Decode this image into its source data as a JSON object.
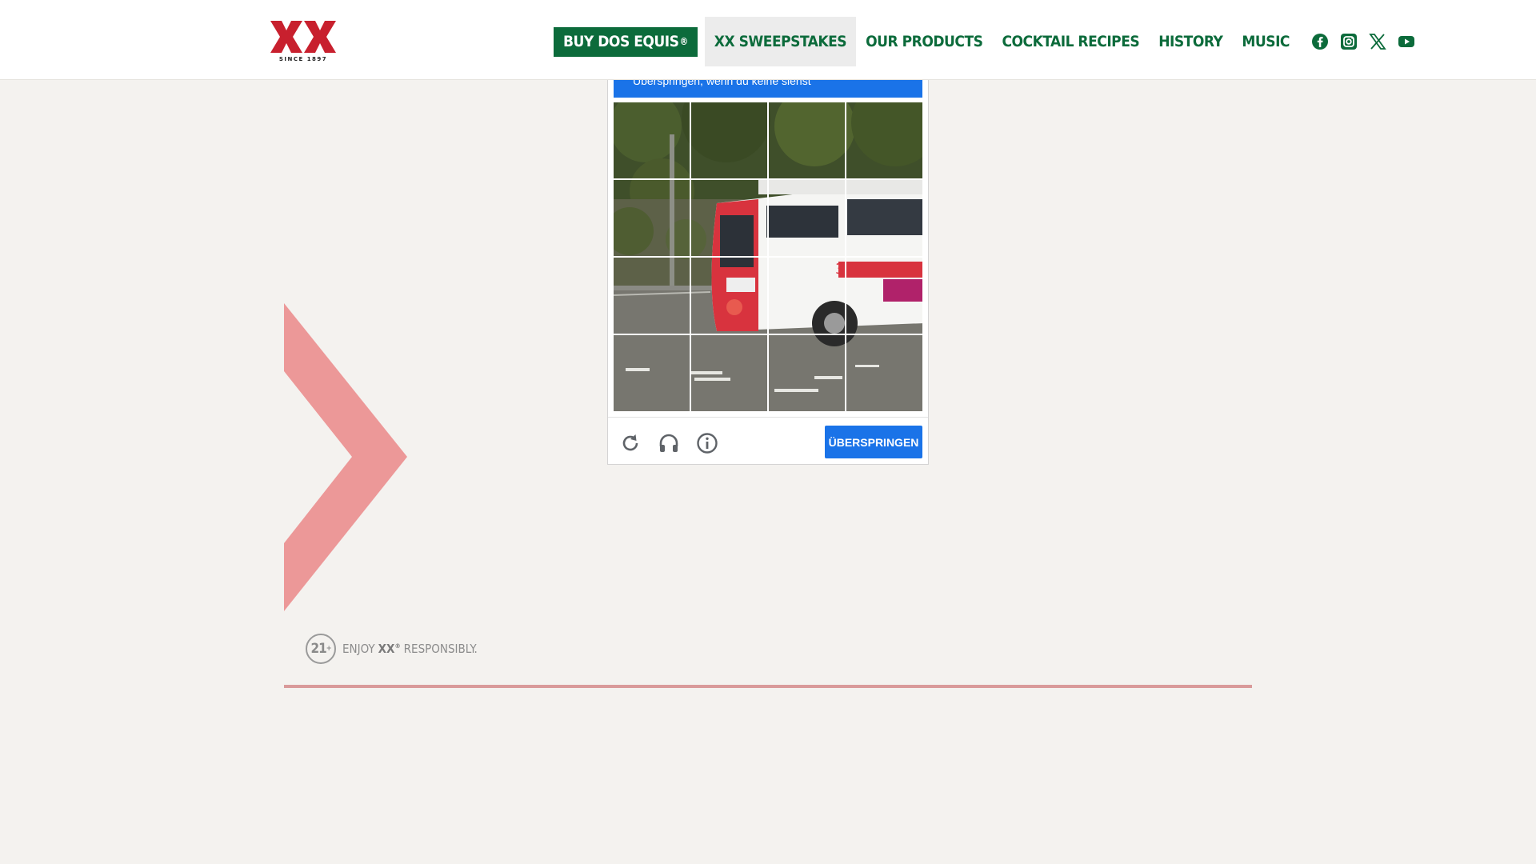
{
  "header": {
    "logo_sub": "SINCE 1897",
    "nav": {
      "buy": "BUY DOS EQUIS",
      "buy_mark": "®",
      "sweepstakes": "XX SWEEPSTAKES",
      "products": "OUR PRODUCTS",
      "cocktails": "COCKTAIL RECIPES",
      "history": "HISTORY",
      "music": "MUSIC"
    },
    "socials": [
      "facebook-icon",
      "instagram-icon",
      "x-icon",
      "youtube-icon"
    ],
    "accent_color": "#0c6b3b"
  },
  "captcha": {
    "banner_text": "Überspringen, wenn du keine siehst",
    "grid": {
      "rows": 4,
      "cols": 4
    },
    "toolbar_icons": [
      "reload-icon",
      "headphones-icon",
      "info-icon"
    ],
    "skip_label": "ÜBERSPRINGEN",
    "accent_color": "#1a73e8"
  },
  "footer": {
    "age_badge": "21",
    "age_badge_mark": "+",
    "enjoy": "ENJOY",
    "brand": "XX",
    "brand_mark": "®",
    "responsibly": "RESPONSIBLY."
  }
}
